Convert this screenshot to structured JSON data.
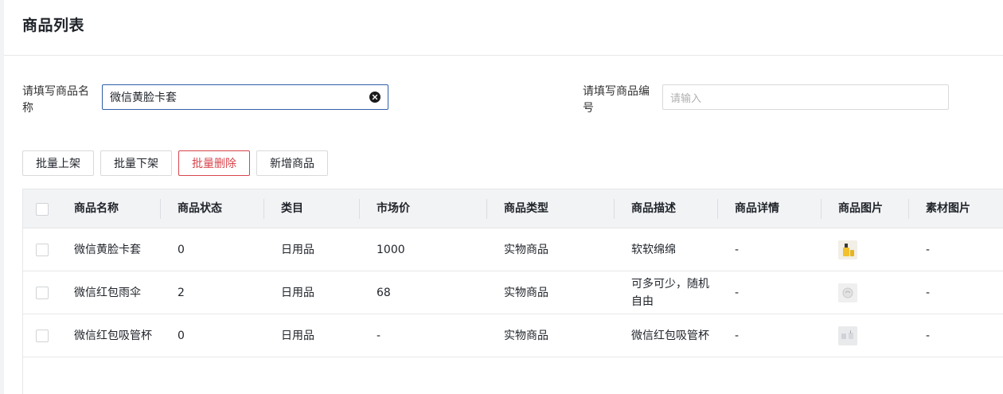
{
  "page": {
    "title": "商品列表"
  },
  "filters": {
    "name": {
      "label": "请填写商品名称",
      "value": "微信黄脸卡套"
    },
    "code": {
      "label": "请填写商品编号",
      "placeholder": "请输入"
    }
  },
  "toolbar": {
    "batch_on": "批量上架",
    "batch_off": "批量下架",
    "batch_delete": "批量删除",
    "add": "新增商品"
  },
  "table": {
    "columns": [
      "商品名称",
      "商品状态",
      "类目",
      "市场价",
      "商品类型",
      "商品描述",
      "商品详情",
      "商品图片",
      "素材图片"
    ],
    "rows": [
      {
        "name": "微信黄脸卡套",
        "status": "0",
        "category": "日用品",
        "price": "1000",
        "type": "实物商品",
        "desc": "软软绵绵",
        "detail": "-",
        "image": "product-image-yellow",
        "material": "-"
      },
      {
        "name": "微信红包雨伞",
        "status": "2",
        "category": "日用品",
        "price": "68",
        "type": "实物商品",
        "desc": "可多可少，随机自由",
        "detail": "-",
        "image": "product-image-umbrella",
        "material": "-"
      },
      {
        "name": "微信红包吸管杯",
        "status": "0",
        "category": "日用品",
        "price": "-",
        "type": "实物商品",
        "desc": "微信红包吸管杯",
        "detail": "-",
        "image": "product-image-cup",
        "material": "-"
      }
    ]
  },
  "colors": {
    "accent": "#2f5fa8",
    "danger": "#d7454c",
    "header_bg": "#f2f3f5"
  }
}
